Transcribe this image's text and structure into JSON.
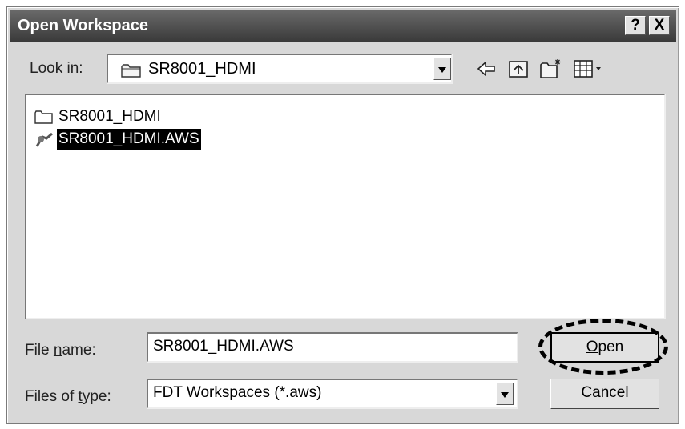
{
  "dialog": {
    "title": "Open Workspace",
    "help_label": "?",
    "close_label": "X"
  },
  "look_in": {
    "label_pre": "Look ",
    "label_access": "in",
    "label_post": ":",
    "value": "SR8001_HDMI"
  },
  "toolbar": {
    "icons": [
      "back-arrow-icon",
      "up-folder-icon",
      "new-folder-icon",
      "view-menu-icon"
    ]
  },
  "files": [
    {
      "name": "SR8001_HDMI",
      "icon": "folder-icon",
      "selected": false
    },
    {
      "name": "SR8001_HDMI.AWS",
      "icon": "workspace-file-icon",
      "selected": true
    }
  ],
  "file_name": {
    "label_pre": "File ",
    "label_access": "n",
    "label_post": "ame:",
    "value": "SR8001_HDMI.AWS"
  },
  "file_type": {
    "label_pre": "Files of ",
    "label_access": "t",
    "label_post": "ype:",
    "value": "FDT Workspaces (*.aws)"
  },
  "buttons": {
    "open_access": "O",
    "open_rest": "pen",
    "cancel": "Cancel"
  }
}
